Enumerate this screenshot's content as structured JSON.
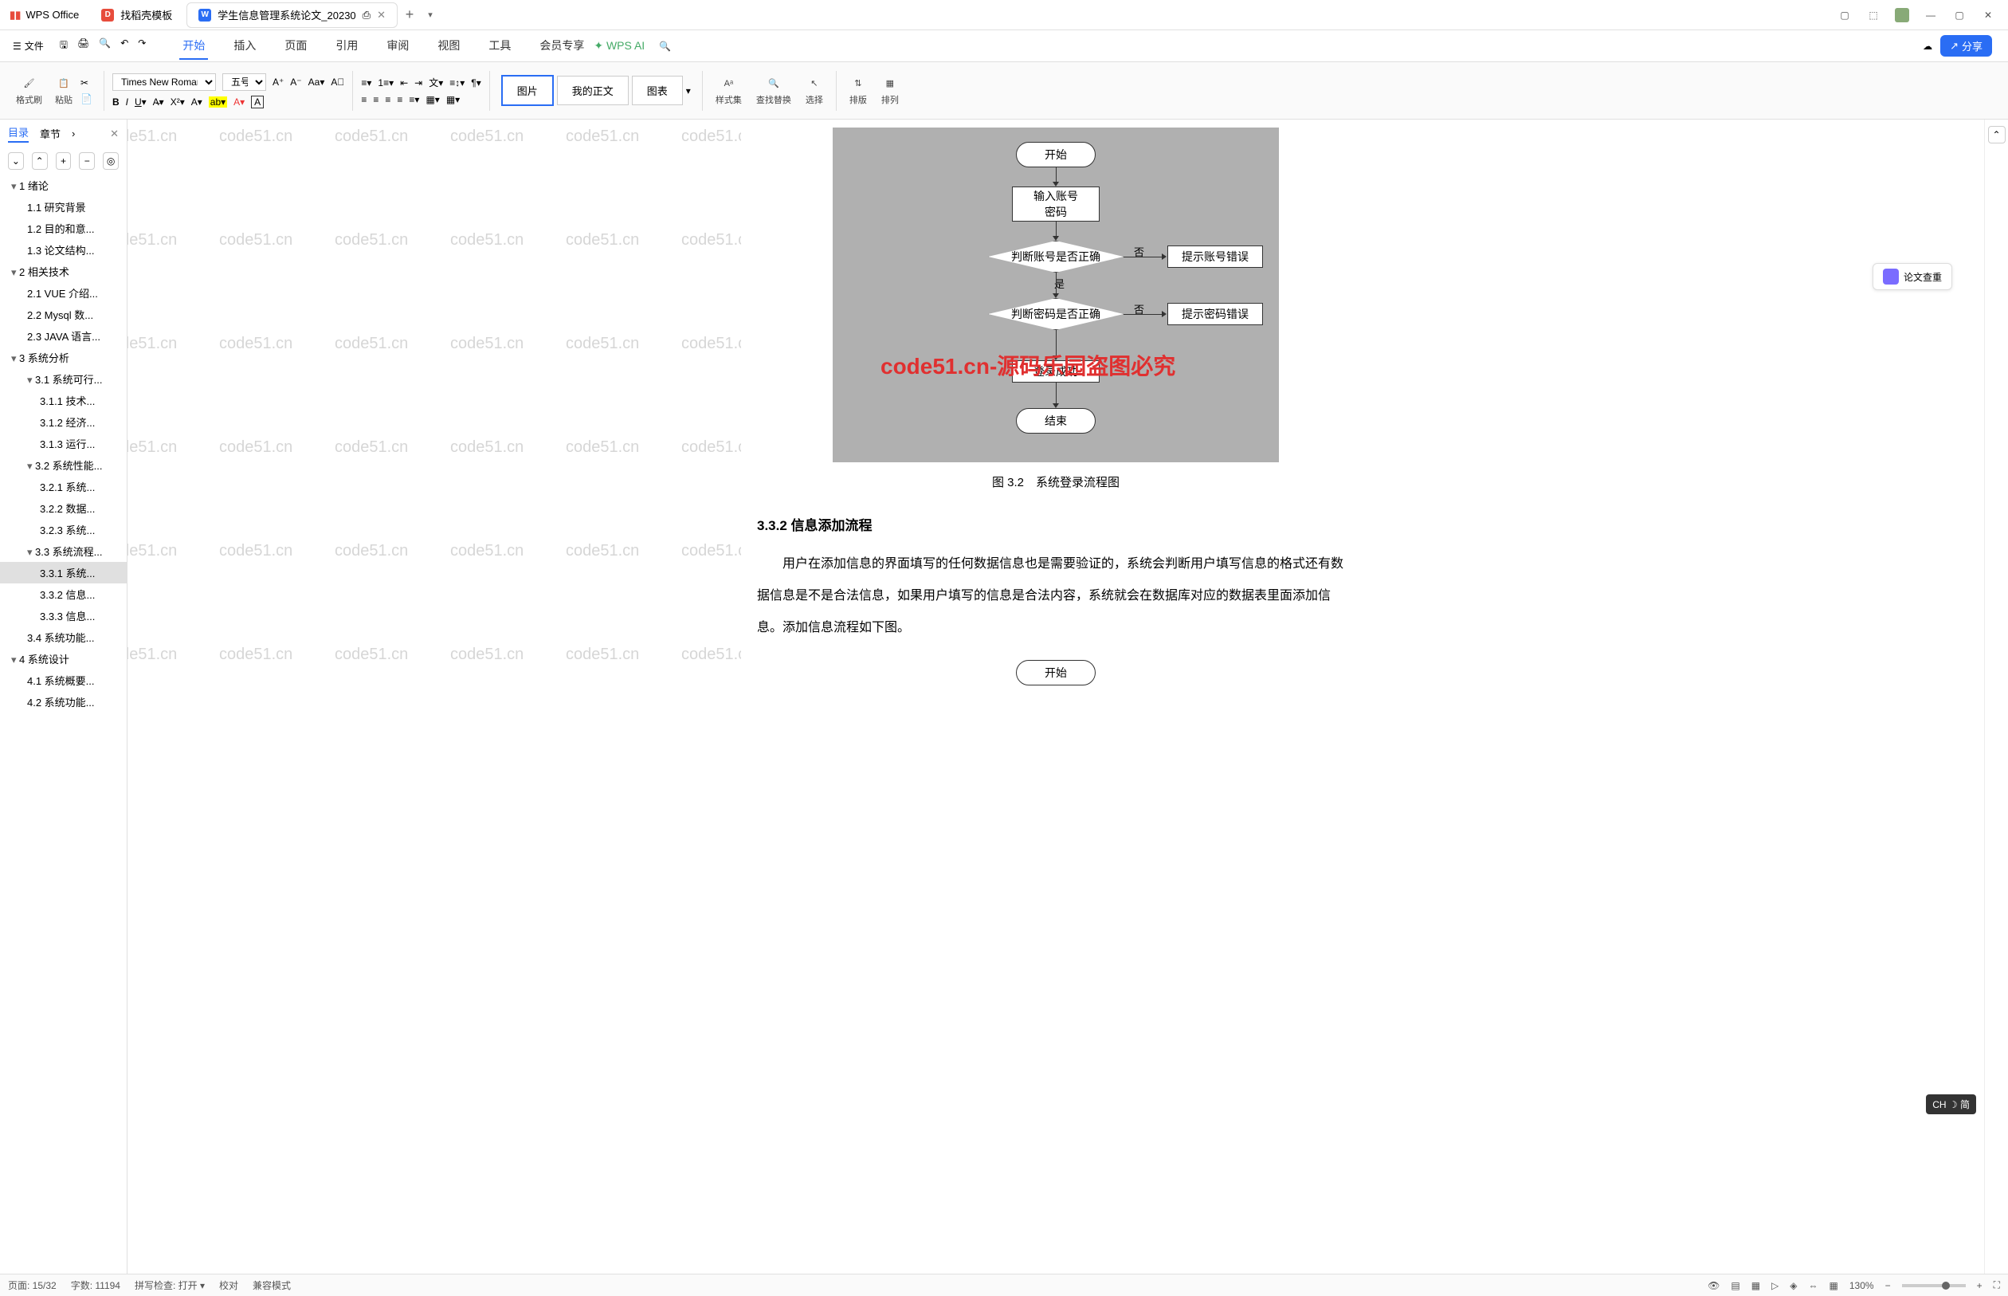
{
  "app": {
    "name": "WPS Office"
  },
  "tabs": [
    {
      "icon_bg": "#e74c3c",
      "icon_text": "D",
      "label": "找稻壳模板",
      "active": false
    },
    {
      "icon_bg": "#2a6df4",
      "icon_text": "W",
      "label": "学生信息管理系统论文_20230",
      "active": true
    }
  ],
  "win": {
    "min": "—",
    "max": "▢",
    "close": "✕"
  },
  "hamburger": "文件",
  "menus": [
    "开始",
    "插入",
    "页面",
    "引用",
    "审阅",
    "视图",
    "工具",
    "会员专享"
  ],
  "active_menu": 0,
  "wps_ai": "WPS AI",
  "cloud_icon": "☁",
  "share": "分享",
  "ribbon": {
    "format_painter": "格式刷",
    "paste": "粘贴",
    "font": "Times New Roman",
    "size": "五号",
    "styles": {
      "pic": "图片",
      "my_body": "我的正文",
      "chart": "图表"
    },
    "styleset": "样式集",
    "findreplace": "查找替换",
    "select": "选择",
    "arrange": "排版",
    "order": "排列"
  },
  "side": {
    "tab1": "目录",
    "tab2": "章节",
    "toc": [
      {
        "l": 1,
        "t": "1 绪论",
        "c": true
      },
      {
        "l": 2,
        "t": "1.1 研究背景"
      },
      {
        "l": 2,
        "t": "1.2 目的和意..."
      },
      {
        "l": 2,
        "t": "1.3 论文结构..."
      },
      {
        "l": 1,
        "t": "2 相关技术",
        "c": true
      },
      {
        "l": 2,
        "t": "2.1 VUE 介绍..."
      },
      {
        "l": 2,
        "t": "2.2 Mysql 数..."
      },
      {
        "l": 2,
        "t": "2.3 JAVA 语言..."
      },
      {
        "l": 1,
        "t": "3 系统分析",
        "c": true
      },
      {
        "l": 2,
        "t": "3.1 系统可行...",
        "c": true
      },
      {
        "l": 3,
        "t": "3.1.1 技术..."
      },
      {
        "l": 3,
        "t": "3.1.2 经济..."
      },
      {
        "l": 3,
        "t": "3.1.3 运行..."
      },
      {
        "l": 2,
        "t": "3.2 系统性能...",
        "c": true
      },
      {
        "l": 3,
        "t": "3.2.1 系统..."
      },
      {
        "l": 3,
        "t": "3.2.2 数据..."
      },
      {
        "l": 3,
        "t": "3.2.3 系统..."
      },
      {
        "l": 2,
        "t": "3.3 系统流程...",
        "c": true
      },
      {
        "l": 3,
        "t": "3.3.1 系统...",
        "sel": true
      },
      {
        "l": 3,
        "t": "3.3.2 信息..."
      },
      {
        "l": 3,
        "t": "3.3.3 信息..."
      },
      {
        "l": 2,
        "t": "3.4 系统功能..."
      },
      {
        "l": 1,
        "t": "4 系统设计",
        "c": true
      },
      {
        "l": 2,
        "t": "4.1 系统概要..."
      },
      {
        "l": 2,
        "t": "4.2 系统功能..."
      }
    ]
  },
  "watermark_text": "code51.cn",
  "flow": {
    "start": "开始",
    "input": "输入账号\n密码",
    "check_acct": "判断账号是否正确",
    "acct_err": "提示账号错误",
    "check_pwd": "判断密码是否正确",
    "pwd_err": "提示密码错误",
    "success": "登录成功",
    "end": "结束",
    "yes": "是",
    "no": "否",
    "redtext": "code51.cn-源码乐园盗图必究"
  },
  "caption": "图 3.2　系统登录流程图",
  "heading": "3.3.2 信息添加流程",
  "body": "用户在添加信息的界面填写的任何数据信息也是需要验证的，系统会判断用户填写信息的格式还有数据信息是不是合法信息，如果用户填写的信息是合法内容，系统就会在数据库对应的数据表里面添加信息。添加信息流程如下图。",
  "next_start": "开始",
  "plag": "论文查重",
  "status": {
    "page": "页面: 15/32",
    "words": "字数: 11194",
    "spell": "拼写检查: 打开",
    "proof": "校对",
    "compat": "兼容模式",
    "zoom": "130%"
  },
  "ime": "CH ☽ 简"
}
